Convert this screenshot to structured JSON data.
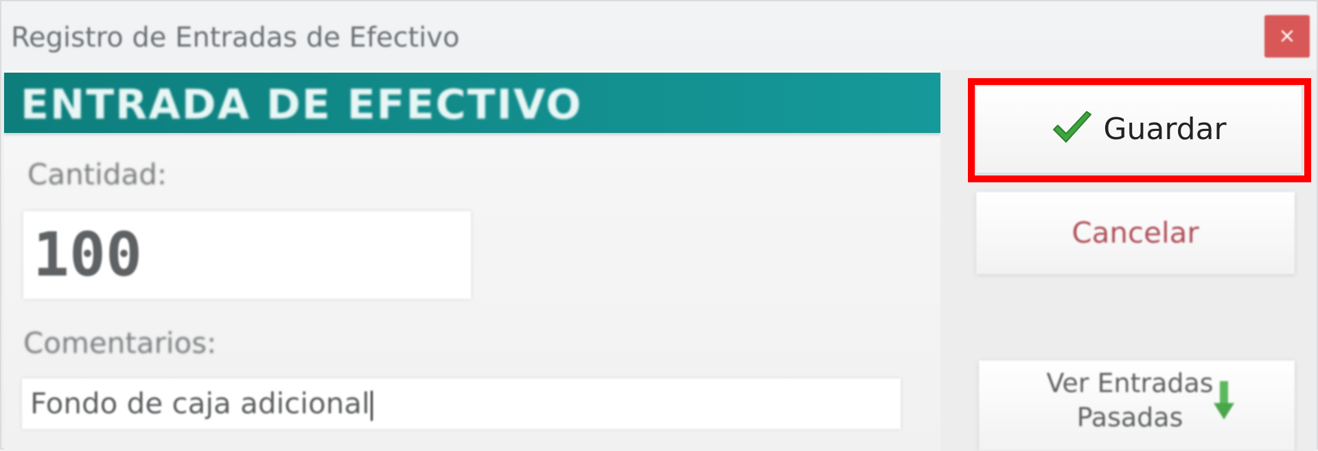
{
  "window": {
    "title": "Registro de Entradas de Efectivo",
    "close_glyph": "×"
  },
  "banner": {
    "title": "ENTRADA DE EFECTIVO"
  },
  "form": {
    "amount_label": "Cantidad:",
    "amount_value": "100",
    "comments_label": "Comentarios:",
    "comments_value": "Fondo de caja adicional"
  },
  "actions": {
    "save_label": "Guardar",
    "cancel_label": "Cancelar",
    "history_label_line1": "Ver Entradas",
    "history_label_line2": "Pasadas"
  },
  "icons": {
    "save": "check-icon",
    "history": "down-arrow-icon"
  },
  "colors": {
    "banner": "#11908f",
    "highlight": "#ff0000",
    "check": "#3fa63f",
    "cancel_text": "#b04f58",
    "close_button": "#d85858"
  }
}
